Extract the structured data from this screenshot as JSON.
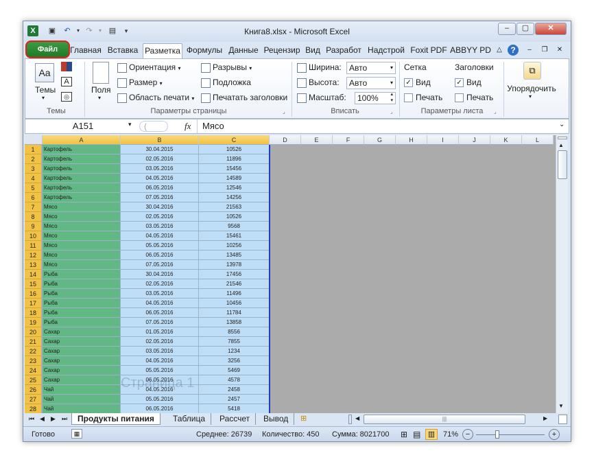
{
  "window": {
    "title": "Книга8.xlsx  -  Microsoft Excel"
  },
  "tabs": [
    "Главная",
    "Вставка",
    "Разметка",
    "Формулы",
    "Данные",
    "Рецензир",
    "Вид",
    "Разработ",
    "Надстрой",
    "Foxit PDF",
    "ABBYY PD"
  ],
  "file_tab": "Файл",
  "ribbon": {
    "themes_label": "Темы",
    "themes_group": "Темы",
    "margins": "Поля",
    "orientation": "Ориентация",
    "size": "Размер",
    "print_area": "Область печати",
    "breaks": "Разрывы",
    "background": "Подложка",
    "print_titles": "Печатать заголовки",
    "page_setup_group": "Параметры страницы",
    "width_label": "Ширина:",
    "width_value": "Авто",
    "height_label": "Высота:",
    "height_value": "Авто",
    "scale_label": "Масштаб:",
    "scale_value": "100%",
    "fit_group": "Вписать",
    "gridlines": "Сетка",
    "headings": "Заголовки",
    "view": "Вид",
    "print": "Печать",
    "sheet_options_group": "Параметры листа",
    "arrange": "Упорядочить"
  },
  "formula_bar": {
    "name_box": "A151",
    "fx": "fx",
    "content": "Мясо"
  },
  "columns": [
    "A",
    "B",
    "C",
    "D",
    "E",
    "F",
    "G",
    "H",
    "I",
    "J",
    "K",
    "L"
  ],
  "rows": [
    [
      "1",
      "Картофель",
      "30.04.2015",
      "10526"
    ],
    [
      "2",
      "Картофель",
      "02.05.2016",
      "11896"
    ],
    [
      "3",
      "Картофель",
      "03.05.2016",
      "15456"
    ],
    [
      "4",
      "Картофель",
      "04.05.2016",
      "14589"
    ],
    [
      "5",
      "Картофель",
      "06.05.2016",
      "12546"
    ],
    [
      "6",
      "Картофель",
      "07.05.2016",
      "14256"
    ],
    [
      "7",
      "Мясо",
      "30.04.2016",
      "21563"
    ],
    [
      "8",
      "Мясо",
      "02.05.2016",
      "10526"
    ],
    [
      "9",
      "Мясо",
      "03.05.2016",
      "9568"
    ],
    [
      "10",
      "Мясо",
      "04.05.2016",
      "15461"
    ],
    [
      "11",
      "Мясо",
      "05.05.2016",
      "10256"
    ],
    [
      "12",
      "Мясо",
      "06.05.2016",
      "13485"
    ],
    [
      "13",
      "Мясо",
      "07.05.2016",
      "13978"
    ],
    [
      "14",
      "Рыба",
      "30.04.2016",
      "17456"
    ],
    [
      "15",
      "Рыба",
      "02.05.2016",
      "21546"
    ],
    [
      "16",
      "Рыба",
      "03.05.2016",
      "11496"
    ],
    [
      "17",
      "Рыба",
      "04.05.2016",
      "10456"
    ],
    [
      "18",
      "Рыба",
      "06.05.2016",
      "11784"
    ],
    [
      "19",
      "Рыба",
      "07.05.2016",
      "13858"
    ],
    [
      "20",
      "Сахар",
      "01.05.2016",
      "8556"
    ],
    [
      "21",
      "Сахар",
      "02.05.2016",
      "7855"
    ],
    [
      "22",
      "Сахар",
      "03.05.2016",
      "1234"
    ],
    [
      "23",
      "Сахар",
      "04.05.2016",
      "3256"
    ],
    [
      "24",
      "Сахар",
      "05.05.2016",
      "5469"
    ],
    [
      "25",
      "Сахар",
      "06.05.2016",
      "4578"
    ],
    [
      "26",
      "Чай",
      "04.05.2016",
      "2458"
    ],
    [
      "27",
      "Чай",
      "05.05.2016",
      "2457"
    ],
    [
      "28",
      "Чай",
      "06.05.2016",
      "5418"
    ]
  ],
  "page_watermark": "Страница 1",
  "sheets": [
    "Продукты питания",
    "Таблица",
    "Рассчет",
    "Вывод"
  ],
  "status": {
    "ready": "Готово",
    "average": "Среднее: 26739",
    "count": "Количество: 450",
    "sum": "Сумма: 8021700",
    "zoom": "71%"
  }
}
